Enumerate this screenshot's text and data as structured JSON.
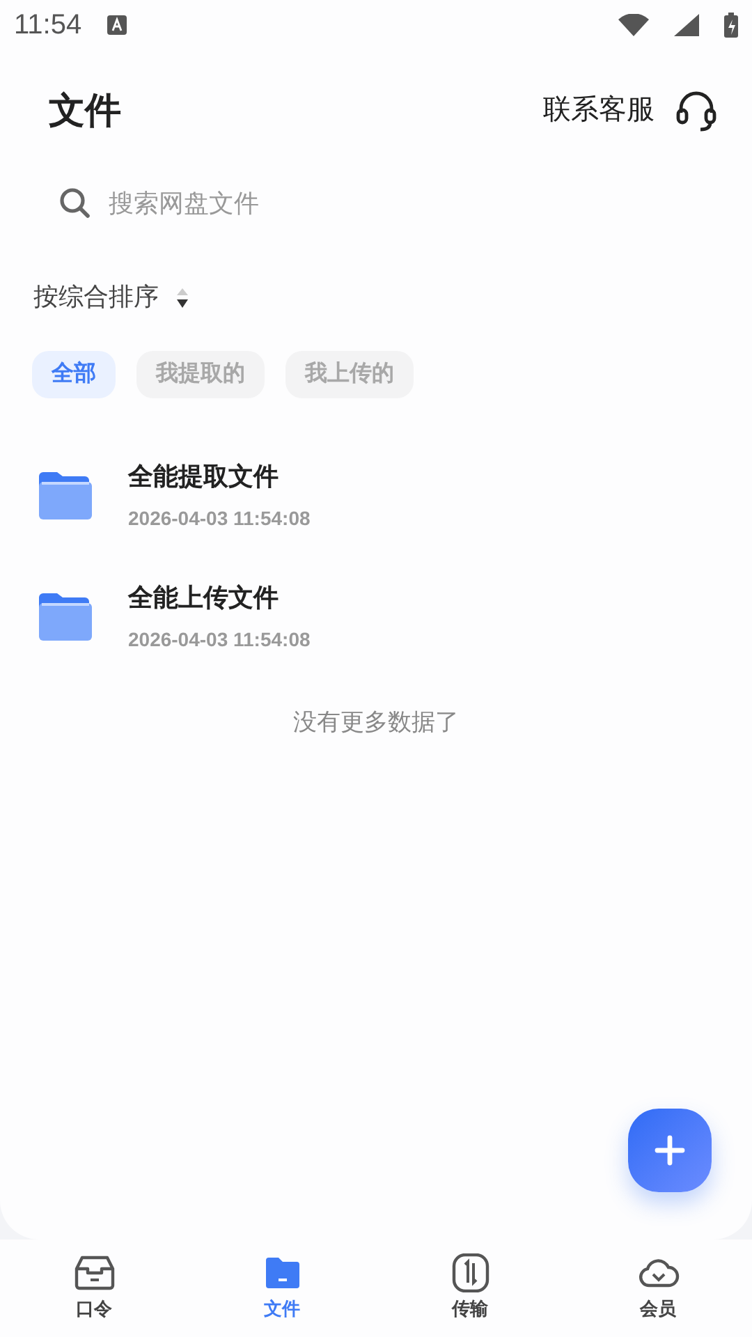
{
  "status_bar": {
    "time": "11:54"
  },
  "header": {
    "title": "文件",
    "support": "联系客服"
  },
  "search": {
    "placeholder": "搜索网盘文件"
  },
  "sort": {
    "label": "按综合排序"
  },
  "filters": [
    {
      "label": "全部",
      "selected": true
    },
    {
      "label": "我提取的",
      "selected": false
    },
    {
      "label": "我上传的",
      "selected": false
    }
  ],
  "files": [
    {
      "name": "全能提取文件",
      "date": "2026-04-03 11:54:08"
    },
    {
      "name": "全能上传文件",
      "date": "2026-04-03 11:54:08"
    }
  ],
  "list_end": "没有更多数据了",
  "tabs": [
    {
      "label": "口令",
      "selected": false
    },
    {
      "label": "文件",
      "selected": true
    },
    {
      "label": "传输",
      "selected": false
    },
    {
      "label": "会员",
      "selected": false
    }
  ]
}
